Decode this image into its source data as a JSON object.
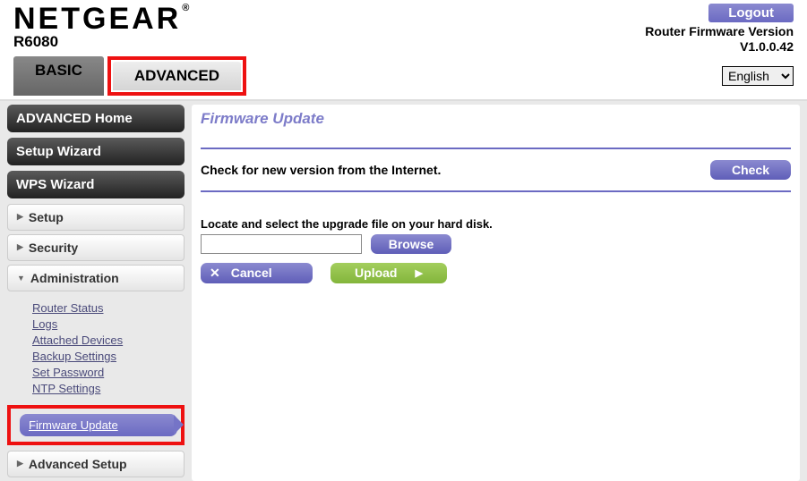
{
  "header": {
    "brand": "NETGEAR",
    "model": "R6080",
    "logout": "Logout",
    "fw_label": "Router Firmware Version",
    "fw_value": "V1.0.0.42"
  },
  "tabs": {
    "basic": "BASIC",
    "advanced": "ADVANCED"
  },
  "language": {
    "selected": "English"
  },
  "sidebar": {
    "adv_home": "ADVANCED Home",
    "setup_wizard": "Setup Wizard",
    "wps_wizard": "WPS Wizard",
    "sections": {
      "setup": "Setup",
      "security": "Security",
      "administration": "Administration",
      "advanced_setup": "Advanced Setup"
    },
    "admin_items": {
      "router_status": "Router Status",
      "logs": "Logs",
      "attached_devices": "Attached Devices",
      "backup_settings": "Backup Settings",
      "set_password": "Set Password",
      "ntp_settings": "NTP Settings",
      "firmware_update": "Firmware Update"
    }
  },
  "content": {
    "title": "Firmware Update",
    "check_text": "Check for new version from the Internet.",
    "check_btn": "Check",
    "locate_text": "Locate and select the upgrade file on your hard disk.",
    "browse_btn": "Browse",
    "cancel_btn": "Cancel",
    "upload_btn": "Upload",
    "file_value": ""
  }
}
